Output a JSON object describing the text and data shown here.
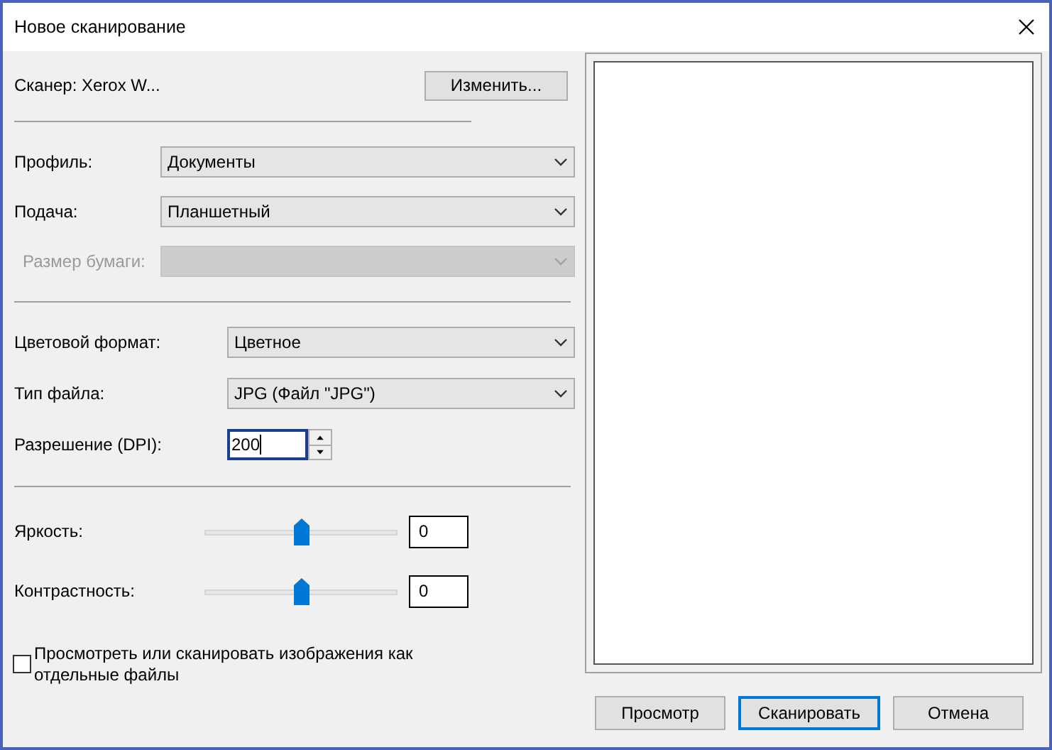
{
  "window": {
    "title": "Новое сканирование"
  },
  "scanner": {
    "label": "Сканер: Xerox W...",
    "button": "Изменить..."
  },
  "groups": [
    {
      "rows": [
        {
          "kind": "select",
          "label": "Профиль:",
          "value": "Документы",
          "disabled": false
        },
        {
          "kind": "select",
          "label": "Подача:",
          "value": "Планшетный",
          "disabled": false
        },
        {
          "kind": "select",
          "label": "Размер бумаги:",
          "value": "",
          "disabled": true
        }
      ]
    },
    {
      "rows": [
        {
          "kind": "select",
          "label": "Цветовой формат:",
          "value": "Цветное",
          "disabled": false
        },
        {
          "kind": "select",
          "label": "Тип файла:",
          "value": "JPG (Файл \"JPG\")",
          "disabled": false
        },
        {
          "kind": "spin",
          "label": "Разрешение (DPI):",
          "value": "200",
          "disabled": false
        }
      ]
    },
    {
      "rows": [
        {
          "kind": "slider",
          "label": "Яркость:",
          "value": "0",
          "level": 0.5
        },
        {
          "kind": "slider",
          "label": "Контрастность:",
          "value": "0",
          "level": 0.5
        }
      ]
    }
  ],
  "separate_files": {
    "label": "Просмотреть или сканировать изображения как отдельные файлы",
    "checked": false
  },
  "buttons": [
    {
      "label": "Просмотр",
      "default": false
    },
    {
      "label": "Сканировать",
      "default": true
    },
    {
      "label": "Отмена",
      "default": false
    }
  ]
}
